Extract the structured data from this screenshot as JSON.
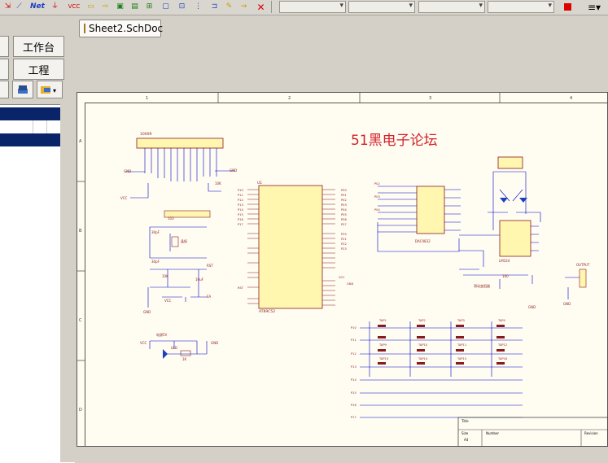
{
  "toolbar": {
    "net_label": "Net",
    "vcc_label": "VCC"
  },
  "left_panel": {
    "workbench_label": "工作台",
    "project_label": "工程"
  },
  "tabs": [
    {
      "label": "Sheet2.SchDoc"
    }
  ],
  "schematic": {
    "title": "51黑电子论坛",
    "chips": {
      "u1": "U1",
      "u1_part": "AT89C52",
      "u2_part": "DAC0832",
      "u3_part": "LM324",
      "res_pack": "1000R",
      "res_pack2": "103"
    },
    "nets": [
      "P10",
      "P11",
      "P12",
      "P13",
      "P14",
      "P15",
      "P16",
      "P17",
      "P00",
      "P01",
      "P02",
      "P03",
      "P04",
      "P05",
      "P06",
      "P07",
      "P20",
      "P21",
      "P22",
      "P23",
      "P24",
      "P25",
      "P26",
      "P27",
      "RST",
      "P3",
      "P4",
      "EA"
    ],
    "keys": [
      "TAP1",
      "TAP2",
      "TAP3",
      "TAP4",
      "TAP5",
      "TAP6",
      "TAP7",
      "TAP8",
      "TAP9",
      "TAP10",
      "TAP11",
      "TAP12",
      "TAP13",
      "TAP14",
      "TAP15",
      "TAP16"
    ],
    "labels": {
      "gnd": "GND",
      "vcc": "VCC",
      "output": "OUTPUT",
      "pot": "滑动变阻器",
      "power": "电源5V",
      "led": "LED",
      "r_10k": "10K",
      "r_1k": "1K",
      "c_10u": "10uF",
      "c_30p": "30pF",
      "xtal": "晶振",
      "r_100": "100"
    },
    "title_block": {
      "title_label": "Title",
      "size_label": "Size",
      "size_value": "A4",
      "number_label": "Number",
      "revision_label": "Revision"
    },
    "ruler_x": [
      "1",
      "2",
      "3",
      "4"
    ],
    "ruler_y": [
      "A",
      "B",
      "C",
      "D"
    ]
  },
  "colors": {
    "wire": "#0000c8",
    "part": "#8b1a1a",
    "title": "#d5202a",
    "selection": "#0a246a",
    "sheet": "#fffdf2"
  }
}
